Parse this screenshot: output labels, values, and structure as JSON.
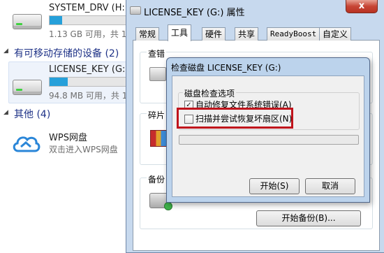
{
  "explorer": {
    "system_drive": {
      "name": "SYSTEM_DRV (H:)",
      "space": "1.13 GB 可用，共 1",
      "used_fraction": 0.15
    },
    "removable_group": {
      "label": "有可移动存储的设备 (2)"
    },
    "license_drive": {
      "name": "LICENSE_KEY (G:)",
      "space": "94.8 MB 可用，共 1",
      "used_fraction": 0.22
    },
    "other_group": {
      "label": "其他 (4)"
    },
    "wps": {
      "name": "WPS网盘",
      "sub": "双击进入WPS网盘"
    }
  },
  "properties": {
    "title": "LICENSE_KEY (G:) 属性",
    "close_glyph": "x",
    "tabs": [
      {
        "label": "常规",
        "active": false
      },
      {
        "label": "工具",
        "active": true
      },
      {
        "label": "硬件",
        "active": false
      },
      {
        "label": "共享",
        "active": false
      },
      {
        "label": "ReadyBoost",
        "active": false
      },
      {
        "label": "自定义",
        "active": false
      }
    ],
    "sections": {
      "check": "查错",
      "defrag": "碎片",
      "backup": "备份"
    },
    "backup_button": "开始备份(B)..."
  },
  "dialog": {
    "title": "检查磁盘 LICENSE_KEY (G:)",
    "group_label": "磁盘检查选项",
    "options": [
      {
        "label": "自动修复文件系统错误(A)",
        "checked": true
      },
      {
        "label": "扫描并尝试恢复坏扇区(N)",
        "checked": false
      }
    ],
    "start_button": "开始(S)",
    "cancel_button": "取消",
    "progress_fraction": 0
  },
  "colors": {
    "highlight_border": "#c0131b",
    "storage_bar": "#26a0da",
    "group_heading": "#1e3287"
  }
}
